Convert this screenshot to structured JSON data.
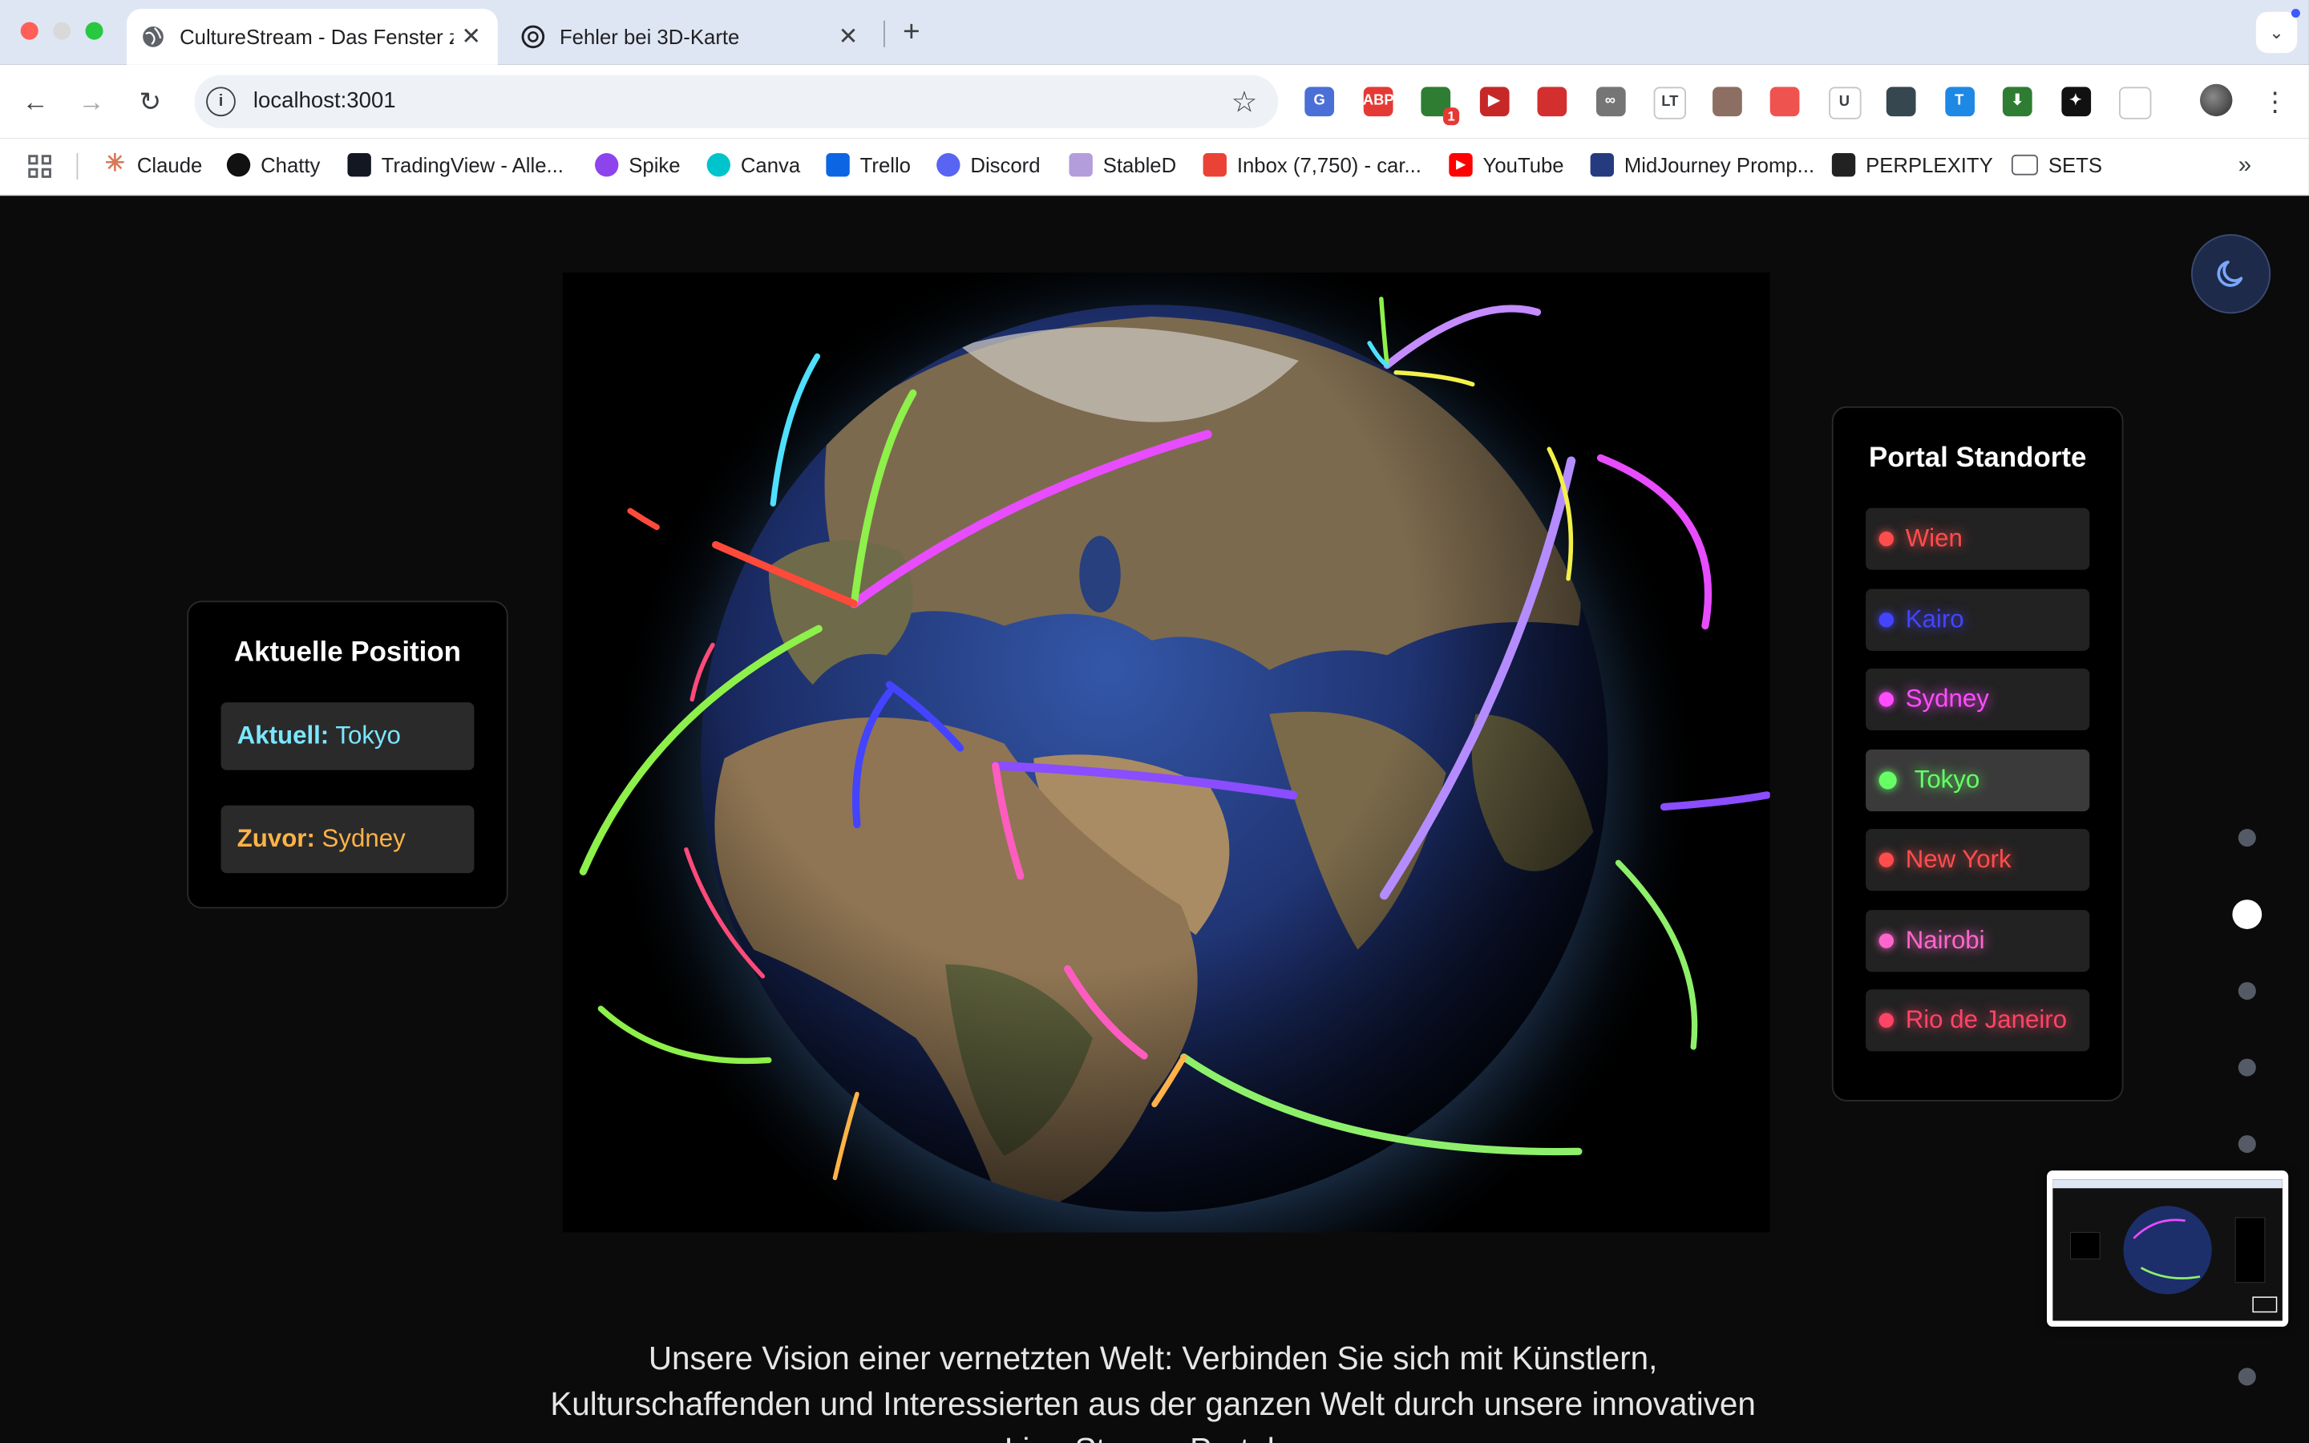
{
  "browser": {
    "tabs": [
      {
        "title": "CultureStream - Das Fenster z",
        "active": true,
        "icon": "globe-icon"
      },
      {
        "title": "Fehler bei 3D-Karte",
        "active": false,
        "icon": "chatgpt-icon"
      }
    ],
    "url": "localhost:3001",
    "extensions": [
      {
        "name": "google-translate-icon",
        "color": "#4a6fd6",
        "label": "G"
      },
      {
        "name": "adblock-plus-icon",
        "color": "#e53935",
        "label": "ABP"
      },
      {
        "name": "extension-badge-icon",
        "color": "#2e7d32",
        "label": "",
        "badge": "1"
      },
      {
        "name": "media-icon",
        "color": "#c62828",
        "label": "▶"
      },
      {
        "name": "shield-icon",
        "color": "#d32f2f",
        "label": ""
      },
      {
        "name": "link-icon",
        "color": "#757575",
        "label": "∞"
      },
      {
        "name": "languagetool-icon",
        "color": "#ffffff",
        "label": "LT"
      },
      {
        "name": "image-icon",
        "color": "#8d6e63",
        "label": ""
      },
      {
        "name": "chat-icon",
        "color": "#ef5350",
        "label": ""
      },
      {
        "name": "u-icon",
        "color": "#ffffff",
        "label": "U"
      },
      {
        "name": "layers-icon",
        "color": "#37474f",
        "label": ""
      },
      {
        "name": "t-icon",
        "color": "#1e88e5",
        "label": "T"
      },
      {
        "name": "download-arrow-icon",
        "color": "#2e7d32",
        "label": "⬇"
      },
      {
        "name": "sparkle-icon",
        "color": "#111111",
        "label": "✦"
      },
      {
        "name": "puzzle-icon",
        "color": "#ffffff",
        "label": ""
      }
    ]
  },
  "bookmarks": [
    {
      "label": "Claude",
      "icon": "claude-icon",
      "color": "#d97757"
    },
    {
      "label": "Chatty",
      "icon": "chatgpt-icon",
      "color": "#111111"
    },
    {
      "label": "TradingView - Alle...",
      "icon": "tradingview-icon",
      "color": "#131722"
    },
    {
      "label": "Spike",
      "icon": "spike-icon",
      "color": "#8e44ec"
    },
    {
      "label": "Canva",
      "icon": "canva-icon",
      "color": "#00c4cc"
    },
    {
      "label": "Trello",
      "icon": "trello-icon",
      "color": "#0c66e4"
    },
    {
      "label": "Discord",
      "icon": "discord-icon",
      "color": "#5865f2"
    },
    {
      "label": "StableD",
      "icon": "rocket-icon",
      "color": "#b39ddb"
    },
    {
      "label": "Inbox (7,750) - car...",
      "icon": "gmail-icon",
      "color": "#ea4335"
    },
    {
      "label": "YouTube",
      "icon": "youtube-icon",
      "color": "#ff0000"
    },
    {
      "label": "MidJourney Promp...",
      "icon": "paypal-icon",
      "color": "#253b80"
    },
    {
      "label": "PERPLEXITY",
      "icon": "perplexity-icon",
      "color": "#222222"
    },
    {
      "label": "SETS",
      "icon": "folder-icon",
      "color": "#5f6368"
    }
  ],
  "position_panel": {
    "title": "Aktuelle Position",
    "current_label": "Aktuell:",
    "current_value": "Tokyo",
    "previous_label": "Zuvor:",
    "previous_value": "Sydney"
  },
  "locations_panel": {
    "title": "Portal Standorte",
    "items": [
      {
        "label": "Wien",
        "color": "#ff4d4d",
        "active": false
      },
      {
        "label": "Kairo",
        "color": "#4444ff",
        "active": false
      },
      {
        "label": "Sydney",
        "color": "#ff4dff",
        "active": false
      },
      {
        "label": "Tokyo",
        "color": "#66ff66",
        "active": true
      },
      {
        "label": "New York",
        "color": "#ff4d4d",
        "active": false
      },
      {
        "label": "Nairobi",
        "color": "#ff66cc",
        "active": false
      },
      {
        "label": "Rio de Janeiro",
        "color": "#ff4466",
        "active": false
      }
    ]
  },
  "theme_toggle": {
    "icon": "moon-icon"
  },
  "section_nav": {
    "count": 6,
    "active_index": 1
  },
  "vision_text": "Unsere Vision einer vernetzten Welt: Verbinden Sie sich mit Künstlern, Kulturschaffenden und Interessierten aus der ganzen Welt durch unsere innovativen Live-Stream-Portale."
}
